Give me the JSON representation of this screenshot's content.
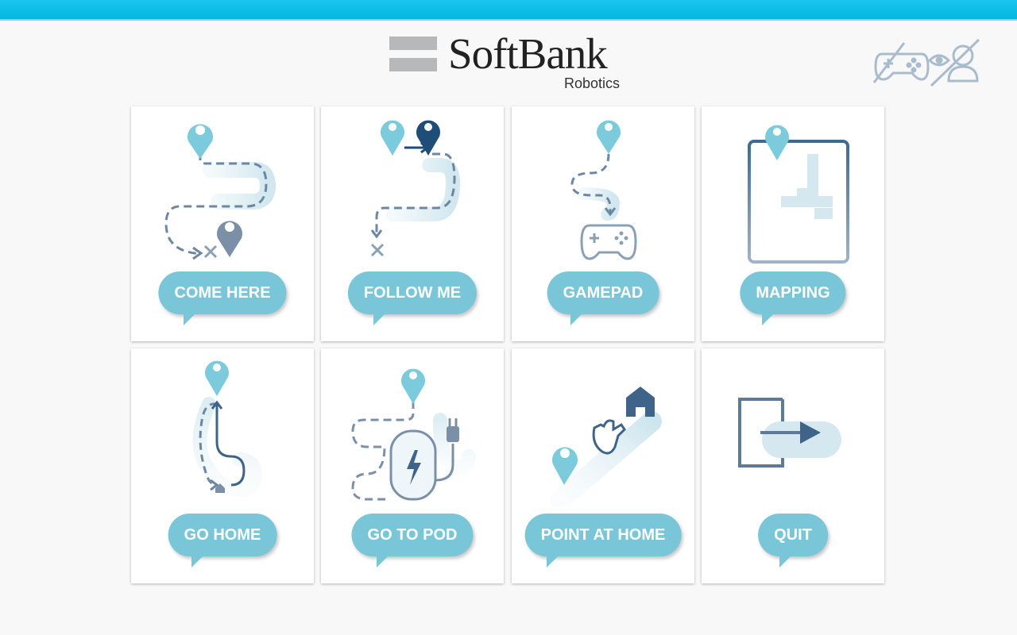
{
  "header": {
    "logo_name": "SoftBank",
    "logo_sub": "Robotics",
    "status_icons": [
      "gamepad-disabled-icon",
      "human-detection-disabled-icon"
    ]
  },
  "tiles": [
    {
      "label": "COME HERE",
      "icon": "come-here-icon"
    },
    {
      "label": "FOLLOW ME",
      "icon": "follow-me-icon"
    },
    {
      "label": "GAMEPAD",
      "icon": "gamepad-icon"
    },
    {
      "label": "MAPPING",
      "icon": "mapping-icon"
    },
    {
      "label": "GO HOME",
      "icon": "go-home-icon"
    },
    {
      "label": "GO TO POD",
      "icon": "go-to-pod-icon"
    },
    {
      "label": "POINT AT HOME",
      "icon": "point-at-home-icon"
    },
    {
      "label": "QUIT",
      "icon": "quit-icon"
    }
  ],
  "colors": {
    "top_bar": "#00b7e1",
    "bubble": "#78c6d8",
    "pin_light": "#7ccbdc",
    "pin_dark": "#1e4e78",
    "line": "#6d87a3"
  }
}
